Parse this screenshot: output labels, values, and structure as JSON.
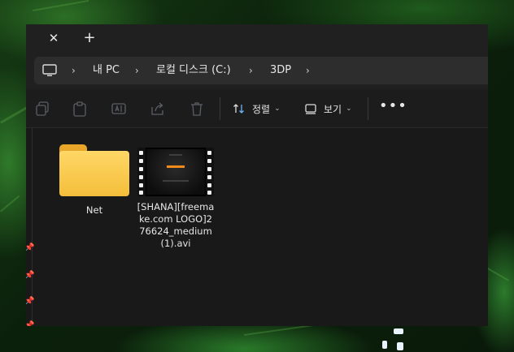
{
  "window": {
    "tab": {
      "close_glyph": "✕",
      "new_glyph": "+"
    },
    "address": {
      "icon": "pc-monitor-icon",
      "breadcrumbs": [
        "내 PC",
        "로컬 디스크 (C:)",
        "3DP"
      ],
      "separator_glyph": "›"
    },
    "toolbar": {
      "icons": [
        "copy-icon",
        "paste-icon",
        "rename-icon",
        "share-icon",
        "delete-icon"
      ],
      "sort_label": "정렬",
      "view_label": "보기",
      "dropdown_glyph": "⌄",
      "more_glyph": "•••"
    },
    "content": {
      "items": [
        {
          "type": "folder",
          "name": "Net"
        },
        {
          "type": "video",
          "name": "[SHANA][freemake.com LOGO]276624_medium (1).avi"
        }
      ]
    }
  },
  "colors": {
    "window_bg": "#191919",
    "titlebar_bg": "#202020",
    "address_box": "#2d2d2d",
    "text": "#e6e6e6",
    "folder": "#f4be3a"
  }
}
